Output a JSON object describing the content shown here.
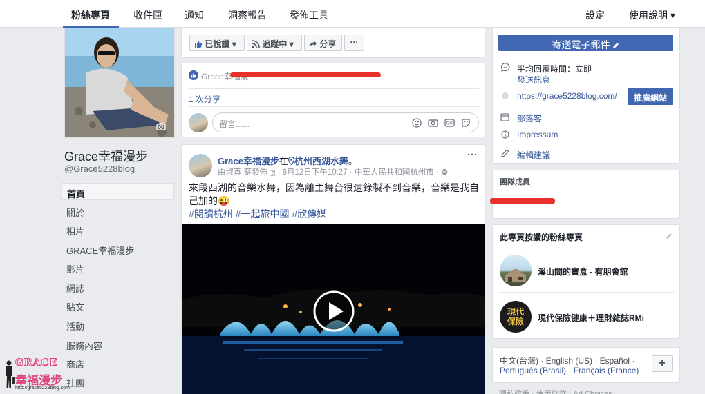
{
  "topbar": {
    "tabs": [
      {
        "label": "粉絲專頁",
        "active": true
      },
      {
        "label": "收件匣",
        "active": false
      },
      {
        "label": "通知",
        "active": false
      },
      {
        "label": "洞察報告",
        "active": false
      },
      {
        "label": "發佈工具",
        "active": false
      }
    ],
    "settings": "設定",
    "help": "使用說明 ▾"
  },
  "profile": {
    "name": "Grace幸福漫步",
    "handle": "@Grace5228blog"
  },
  "sidebar": {
    "items": [
      {
        "label": "首頁",
        "active": true
      },
      {
        "label": "關於"
      },
      {
        "label": "相片"
      },
      {
        "label": "GRACE幸福漫步"
      },
      {
        "label": "影片"
      },
      {
        "label": "網誌"
      },
      {
        "label": "貼文"
      },
      {
        "label": "活動"
      },
      {
        "label": "服務內容"
      },
      {
        "label": "商店"
      },
      {
        "label": "社團"
      }
    ]
  },
  "actions": {
    "liked": "已說讚",
    "following": "追蹤中",
    "share": "分享",
    "more": "···"
  },
  "prev_post": {
    "liker_text": "Grace幸福漫...",
    "shares": "1 次分享",
    "comment_placeholder": "留言......"
  },
  "post": {
    "author": "Grace幸福漫步",
    "at_word": "在",
    "location": "杭州西湖水舞",
    "period": "。",
    "meta_publisher": "由淑真 蔡發佈",
    "meta_date": "· 6月12日下午10:27 · 中華人民共和國杭州市 ·",
    "text": "來段西湖的音樂水舞，因為離主舞台很遠錄製不到音樂，音樂是我自己加的😜",
    "hashtags": "#閱讀杭州 #一起旅中國 #欣傳媒",
    "more": "···"
  },
  "right": {
    "email_button": "寄送電子郵件",
    "response_time": "平均回覆時間：立即",
    "send_message": "發送訊息",
    "website": "https://grace5228blog.com/",
    "promote": "推廣網站",
    "blogger": "部落客",
    "impressum": "Impressum",
    "edit_suggest": "編輯建議",
    "team_title": "團隊成員",
    "liked_pages_title": "此專頁按讚的粉絲專頁",
    "liked_pages": [
      {
        "name": "溪山間的寶盒 - 有朋會館"
      },
      {
        "name": "現代保險健康＋理財雜誌RMi",
        "logo_text_1": "現代",
        "logo_text_2": "保險"
      }
    ],
    "languages_line1": "中文(台灣) · English (US) · Español ·",
    "languages_line2": "Português (Brasil) · Français (France)",
    "plus": "+",
    "footer_cut": "隱私政策 · 使用條款 · Ad Choices"
  },
  "watermark": {
    "brand": "GRACE",
    "title": "幸福漫步",
    "url": "http://grace5228blog.com"
  },
  "colors": {
    "fb_blue": "#4267b2",
    "link": "#385898",
    "red_mark": "#e8312a",
    "watermark_pink": "#e0457b"
  }
}
